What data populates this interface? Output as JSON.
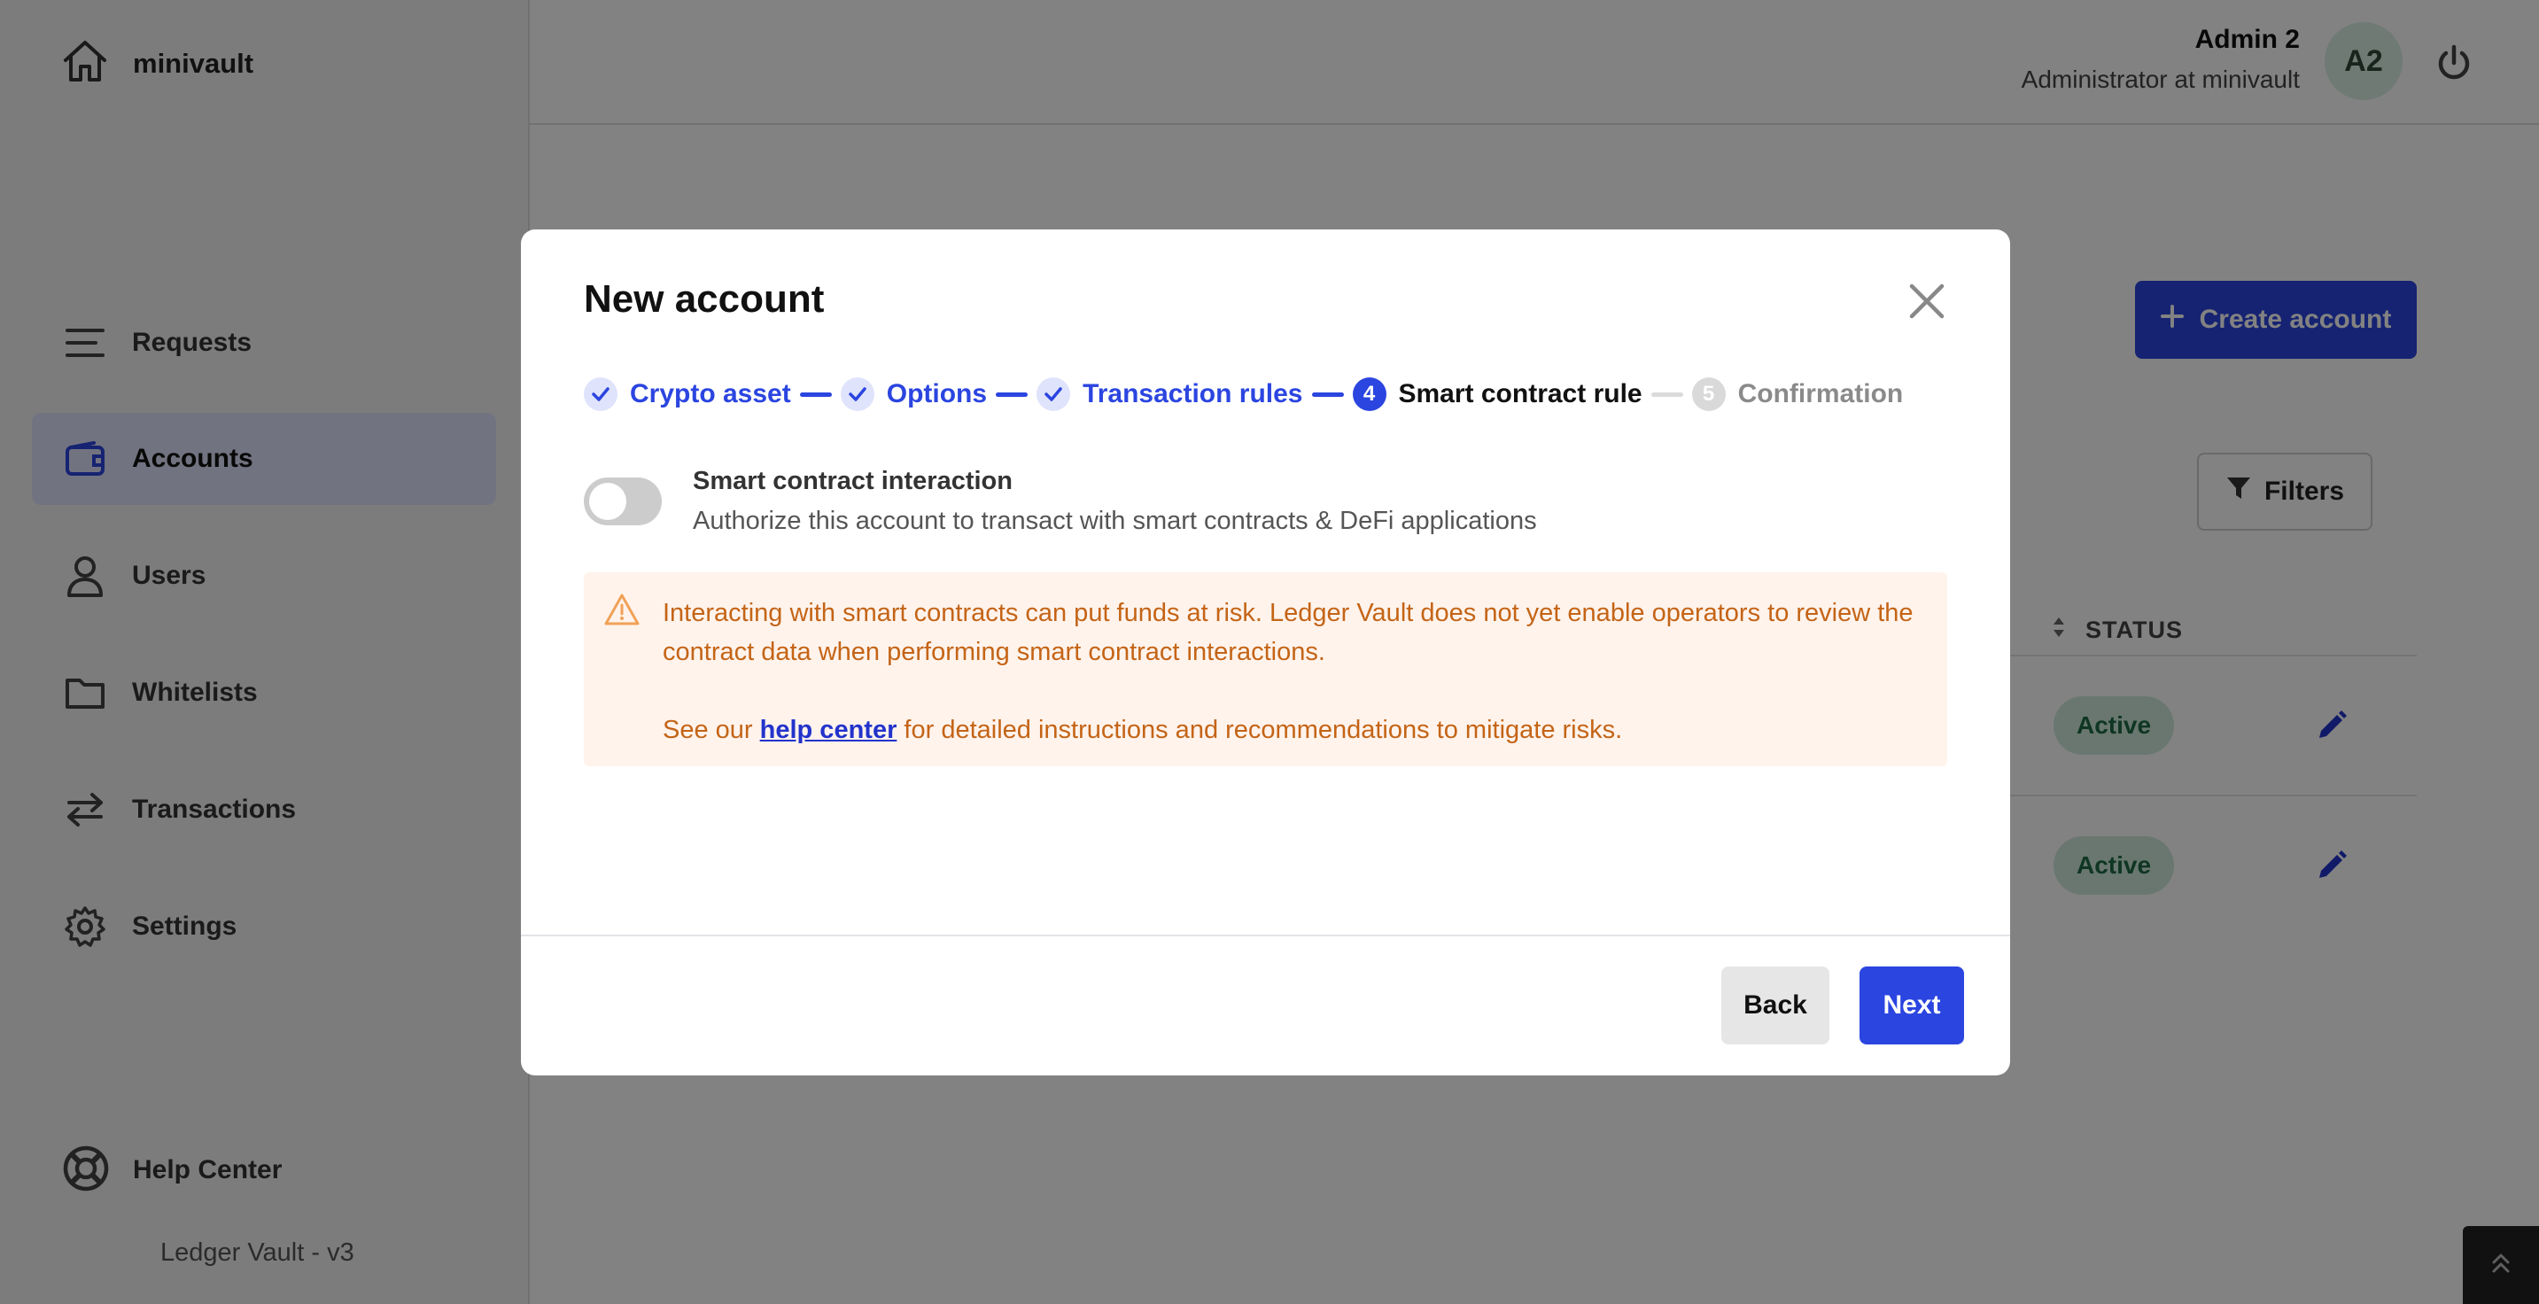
{
  "sidebar": {
    "brand": "minivault",
    "items": [
      {
        "label": "Requests",
        "icon": "menu-lines-icon"
      },
      {
        "label": "Accounts",
        "icon": "wallet-icon",
        "active": true
      },
      {
        "label": "Users",
        "icon": "user-icon"
      },
      {
        "label": "Whitelists",
        "icon": "folder-icon"
      },
      {
        "label": "Transactions",
        "icon": "transfer-arrows-icon"
      },
      {
        "label": "Settings",
        "icon": "gear-icon"
      }
    ],
    "help": "Help Center",
    "version": "Ledger Vault - v3"
  },
  "header": {
    "user_name": "Admin 2",
    "user_role": "Administrator at minivault",
    "avatar_initials": "A2"
  },
  "page": {
    "create_label": "Create account",
    "filters_label": "Filters",
    "status_header": "STATUS",
    "rows": [
      {
        "status": "Active"
      },
      {
        "status": "Active"
      }
    ]
  },
  "modal": {
    "title": "New account",
    "steps": [
      {
        "label": "Crypto asset",
        "state": "done"
      },
      {
        "label": "Options",
        "state": "done"
      },
      {
        "label": "Transaction rules",
        "state": "done"
      },
      {
        "label": "Smart contract rule",
        "state": "current",
        "number": "4"
      },
      {
        "label": "Confirmation",
        "state": "todo",
        "number": "5"
      }
    ],
    "toggle": {
      "title": "Smart contract interaction",
      "description": "Authorize this account to transact with smart contracts & DeFi applications",
      "enabled": false
    },
    "alert": {
      "text": "Interacting with smart contracts can put funds at risk. Ledger Vault does not yet enable operators to review the contract data when performing smart contract interactions.",
      "prefix": "See our ",
      "link": "help center",
      "suffix": " for detailed instructions and recommendations to mitigate risks."
    },
    "back_label": "Back",
    "next_label": "Next"
  },
  "colors": {
    "accent": "#2b45e0",
    "warning_text": "#c46416",
    "warning_bg": "#fff3ec",
    "active_badge_bg": "#cfeadb"
  }
}
